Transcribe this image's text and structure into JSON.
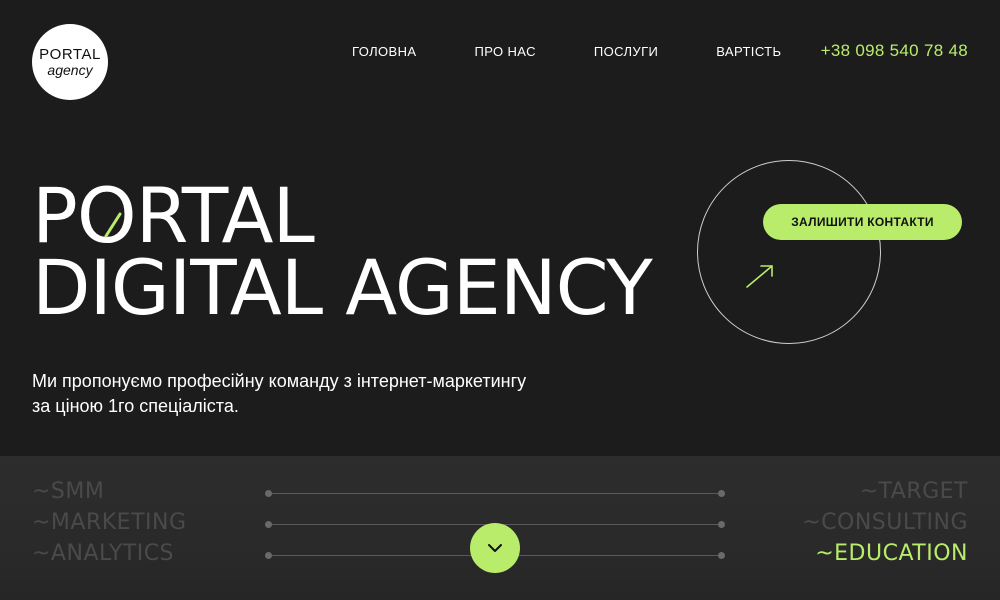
{
  "logo": {
    "line1": "PORTAL",
    "line2": "agency"
  },
  "nav": {
    "items": [
      "ГОЛОВНА",
      "ПРО НАС",
      "ПОСЛУГИ",
      "ВАРТІСТЬ"
    ],
    "phone": "+38 098 540 78 48"
  },
  "hero": {
    "title_line1": "PORTAL",
    "title_line2": "DIGITAL AGENCY",
    "subtitle_line1": "Ми пропонуємо професійну команду з інтернет-маркетингу",
    "subtitle_line2": "за ціною 1го спеціаліста.",
    "cta_label": "ЗАЛИШИТИ КОНТАКТИ"
  },
  "services": {
    "left": [
      "~SMM",
      "~MARKETING",
      "~ANALYTICS"
    ],
    "right": [
      "~TARGET",
      "~CONSULTING",
      "~EDUCATION"
    ],
    "active": "~EDUCATION"
  },
  "icons": {
    "arrow": "arrow-up-right-icon",
    "scroll": "chevron-down-icon"
  },
  "colors": {
    "accent": "#b8ec6a",
    "background": "#1c1c1c",
    "band": "#2a2a2a",
    "muted_text": "#4a4a4a"
  }
}
